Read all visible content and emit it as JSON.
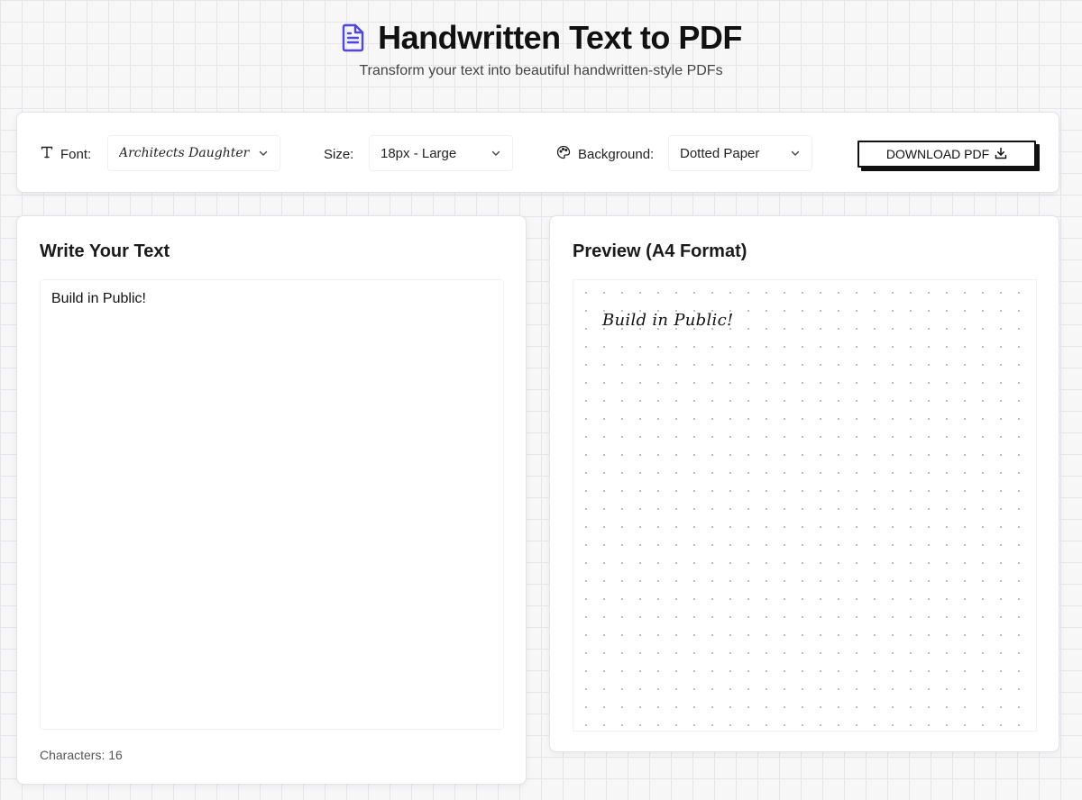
{
  "header": {
    "title": "Handwritten Text to PDF",
    "subtitle": "Transform your text into beautiful handwritten-style PDFs",
    "icon": "document-icon",
    "accent_color": "#4f46e5"
  },
  "toolbar": {
    "font_label": "Font:",
    "font_icon": "type-icon",
    "font_value": "Architects Daughter",
    "size_label": "Size:",
    "size_value": "18px - Large",
    "background_label": "Background:",
    "background_icon": "palette-icon",
    "background_value": "Dotted Paper",
    "download_label": "DOWNLOAD PDF",
    "download_icon": "download-icon"
  },
  "editor": {
    "title": "Write Your Text",
    "text": "Build in Public!",
    "char_label": "Characters:",
    "char_count": "16"
  },
  "preview": {
    "title": "Preview (A4 Format)",
    "text": "Build in Public!"
  }
}
